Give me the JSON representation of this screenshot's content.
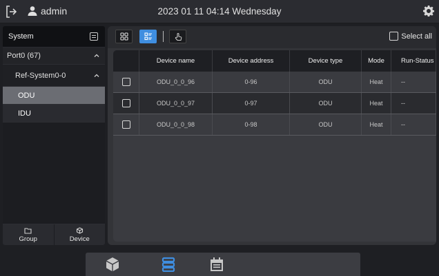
{
  "header": {
    "user": "admin",
    "datetime": "2023 01 11 04:14 Wednesday"
  },
  "sidebar": {
    "title": "System",
    "port": "Port0 (67)",
    "ref_system": "Ref-System0-0",
    "items": [
      {
        "label": "ODU",
        "selected": true
      },
      {
        "label": "IDU",
        "selected": false
      }
    ],
    "buttons": {
      "group": "Group",
      "device": "Device"
    }
  },
  "toolbar": {
    "select_all": "Select all",
    "active_view": "list"
  },
  "table": {
    "columns": [
      "Device name",
      "Device address",
      "Device type",
      "Mode",
      "Run-Status"
    ],
    "rows": [
      {
        "name": "ODU_0_0_96",
        "address": "0-96",
        "type": "ODU",
        "mode": "Heat",
        "status": "--"
      },
      {
        "name": "ODU_0_0_97",
        "address": "0-97",
        "type": "ODU",
        "mode": "Heat",
        "status": "--"
      },
      {
        "name": "ODU_0_0_98",
        "address": "0-98",
        "type": "ODU",
        "mode": "Heat",
        "status": "--"
      }
    ]
  },
  "colors": {
    "accent": "#3f8ee0",
    "selected_row": "#6b6d73",
    "background": "#1e1f23"
  }
}
